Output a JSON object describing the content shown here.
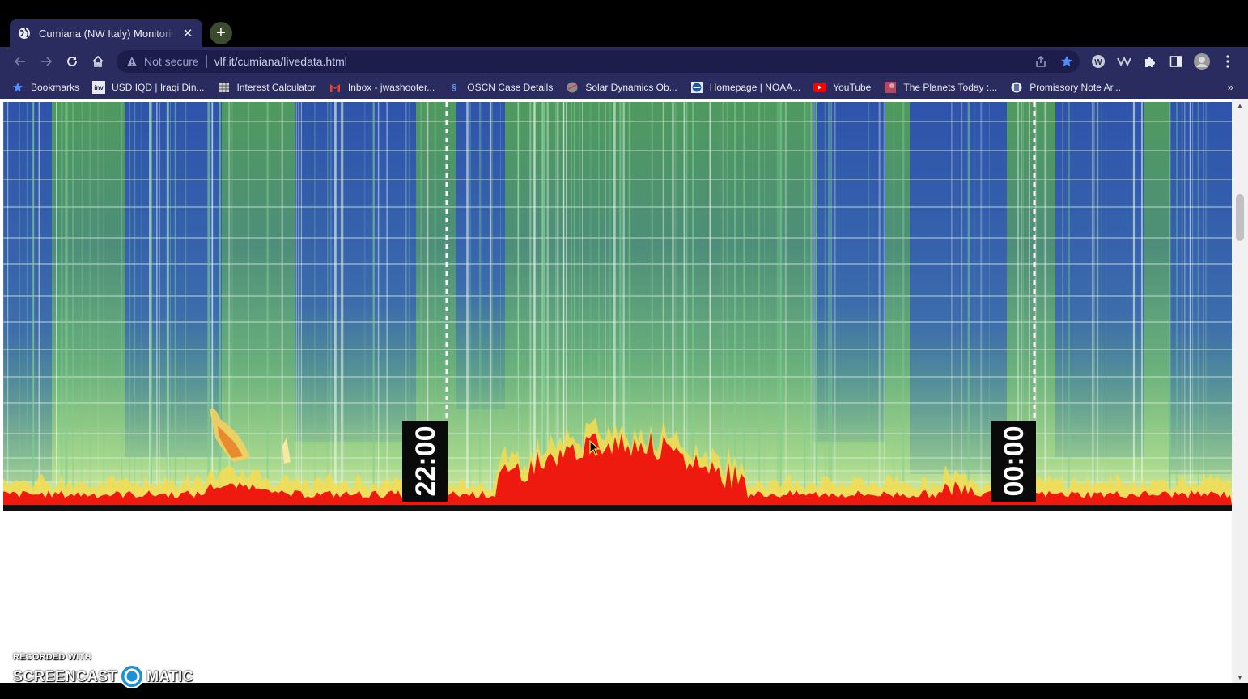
{
  "tab": {
    "title": "Cumiana (NW Italy) Monitoring S",
    "close_icon": "close-icon",
    "favicon": "globe-icon"
  },
  "toolbar": {
    "back_icon": "back-arrow-icon",
    "forward_icon": "forward-arrow-icon",
    "reload_icon": "reload-icon",
    "home_icon": "home-icon",
    "security_label": "Not secure",
    "url": "vlf.it/cumiana/livedata.html"
  },
  "bookmarks": [
    {
      "label": "Bookmarks",
      "icon": "star-icon"
    },
    {
      "label": "USD IQD | Iraqi Din...",
      "icon": "inv-icon"
    },
    {
      "label": "Interest Calculator",
      "icon": "calculator-icon"
    },
    {
      "label": "Inbox - jwashooter...",
      "icon": "gmail-icon"
    },
    {
      "label": "OSCN Case Details",
      "icon": "oscn-icon"
    },
    {
      "label": "Solar Dynamics Ob...",
      "icon": "nasa-icon"
    },
    {
      "label": "Homepage | NOAA...",
      "icon": "noaa-icon"
    },
    {
      "label": "YouTube",
      "icon": "youtube-icon"
    },
    {
      "label": "The Planets Today :...",
      "icon": "planets-icon"
    },
    {
      "label": "Promissory Note Ar...",
      "icon": "document-icon"
    }
  ],
  "bookmarks_overflow": "»",
  "spectrogram": {
    "time_labels": [
      "22:00",
      "00:00"
    ]
  },
  "watermark": {
    "line1": "RECORDED WITH",
    "line2a": "SCREENCAST",
    "line2b": "MATIC"
  },
  "colors": {
    "toolbar": "#2a2b5e",
    "omnibox": "#1c1d4a",
    "star": "#4f8cff"
  }
}
